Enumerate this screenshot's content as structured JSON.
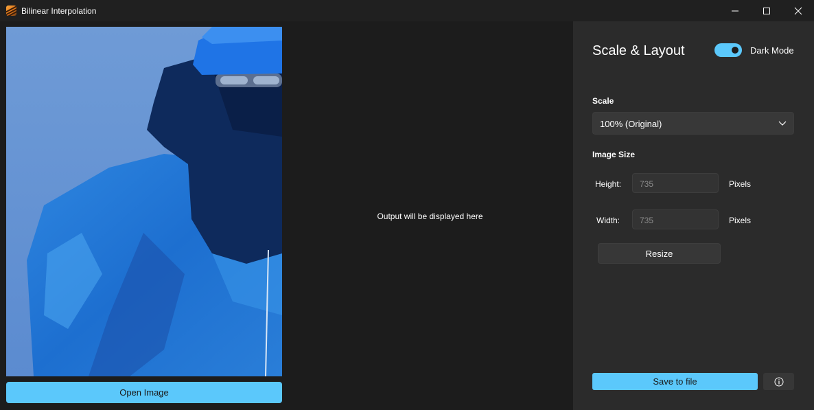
{
  "window": {
    "title": "Bilinear Interpolation",
    "icons": {
      "app": "app-icon",
      "minimize": "minimize-icon",
      "maximize": "maximize-icon",
      "close": "close-icon"
    }
  },
  "left_panel": {
    "open_button_label": "Open Image"
  },
  "output": {
    "placeholder_text": "Output will be displayed here"
  },
  "side_panel": {
    "title": "Scale & Layout",
    "dark_mode": {
      "label": "Dark Mode",
      "enabled": true
    },
    "scale": {
      "label": "Scale",
      "selected": "100% (Original)",
      "icon": "chevron-down-icon"
    },
    "image_size": {
      "label": "Image Size",
      "height": {
        "label": "Height:",
        "value": "735",
        "unit": "Pixels"
      },
      "width": {
        "label": "Width:",
        "value": "735",
        "unit": "Pixels"
      }
    },
    "resize_button_label": "Resize",
    "save_button_label": "Save to file",
    "info_icon": "info-icon"
  },
  "colors": {
    "accent": "#5bc8fb",
    "window_bg": "#1c1c1c",
    "panel_bg": "#2b2b2b",
    "titlebar_bg": "#202020"
  }
}
